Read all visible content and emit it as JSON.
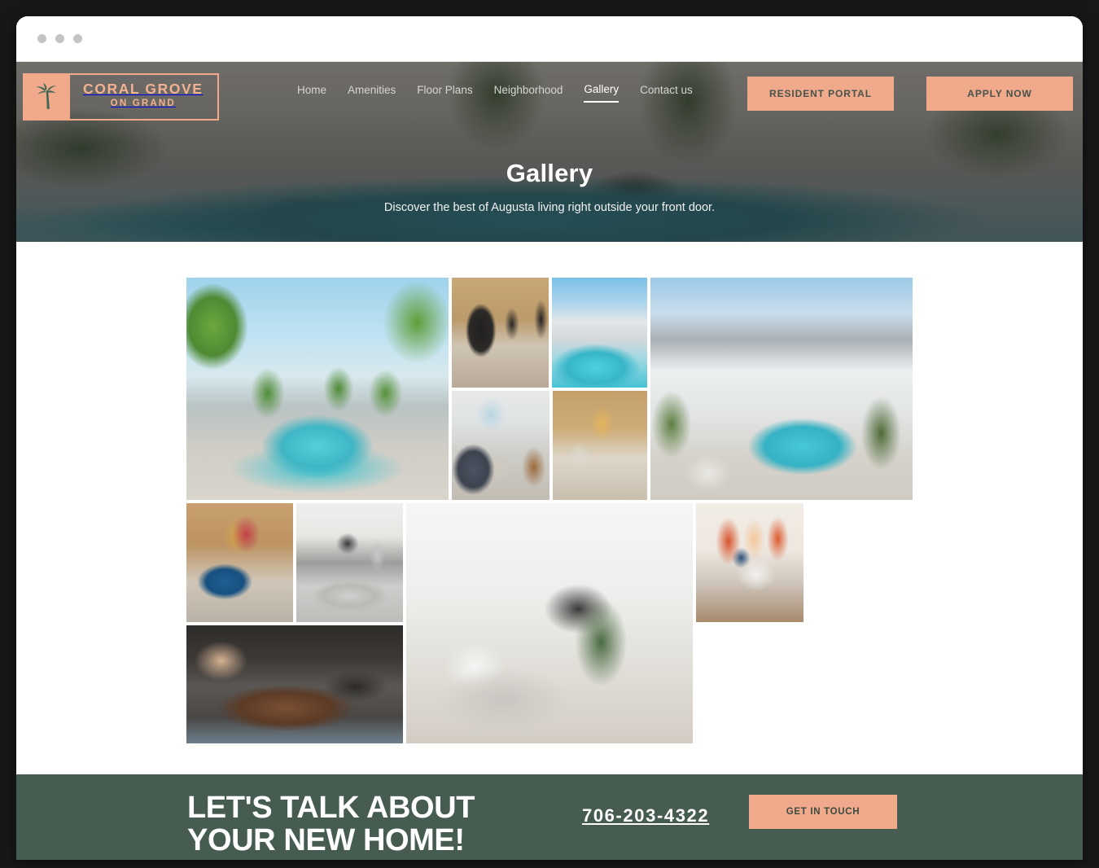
{
  "browser": {
    "dots": [
      "close-dot",
      "minimize-dot",
      "maximize-dot"
    ]
  },
  "header": {
    "logo": {
      "icon": "palm-tree-icon",
      "line1": "CORAL GROVE",
      "line2": "ON GRAND"
    },
    "nav": [
      {
        "label": "Home",
        "active": false
      },
      {
        "label": "Amenities",
        "active": false
      },
      {
        "label": "Floor Plans",
        "active": false
      },
      {
        "label": "Neighborhood",
        "active": false
      },
      {
        "label": "Gallery",
        "active": true
      },
      {
        "label": "Contact us",
        "active": false
      }
    ],
    "resident_portal_label": "RESIDENT PORTAL",
    "apply_now_label": "APPLY NOW"
  },
  "hero": {
    "title": "Gallery",
    "subtitle": "Discover the best of Augusta living right outside your front door."
  },
  "gallery": {
    "images": [
      {
        "name": "rooftop-pool-with-palms",
        "alt": "Rooftop pool surrounded by palm trees and lounge chairs"
      },
      {
        "name": "lounge-hanging-chairs",
        "alt": "Indoor lounge with black hanging egg chairs"
      },
      {
        "name": "apartment-building-pool",
        "alt": "Apartment building exterior with pool"
      },
      {
        "name": "aerial-community-pool",
        "alt": "Aerial view of community buildings and resort pool"
      },
      {
        "name": "living-room-grey-sofa",
        "alt": "Living room with grey sectional sofa and balcony view"
      },
      {
        "name": "lobby-console-artwork",
        "alt": "Lobby console table with mountain artwork"
      },
      {
        "name": "living-room-blue-sofa",
        "alt": "Living room with blue tufted sofa and abstract art"
      },
      {
        "name": "kitchen-granite-counters",
        "alt": "Kitchen with white cabinets and granite counters"
      },
      {
        "name": "grill-station-barbecue",
        "alt": "Outdoor grill station with burgers and kebabs"
      },
      {
        "name": "white-living-room-tv",
        "alt": "Bright white living room with media wall and TV"
      },
      {
        "name": "bedroom-orange-arches",
        "alt": "Bedroom with orange arch mural and iron bed frame"
      }
    ]
  },
  "cta": {
    "title": "LET'S TALK ABOUT YOUR NEW HOME!",
    "phone": "706-203-4322",
    "button_label": "GET IN TOUCH"
  },
  "colors": {
    "accent_peach": "#f0a98a",
    "dark_green": "#475c51",
    "nav_text": "#d6d6d4",
    "white": "#ffffff"
  }
}
